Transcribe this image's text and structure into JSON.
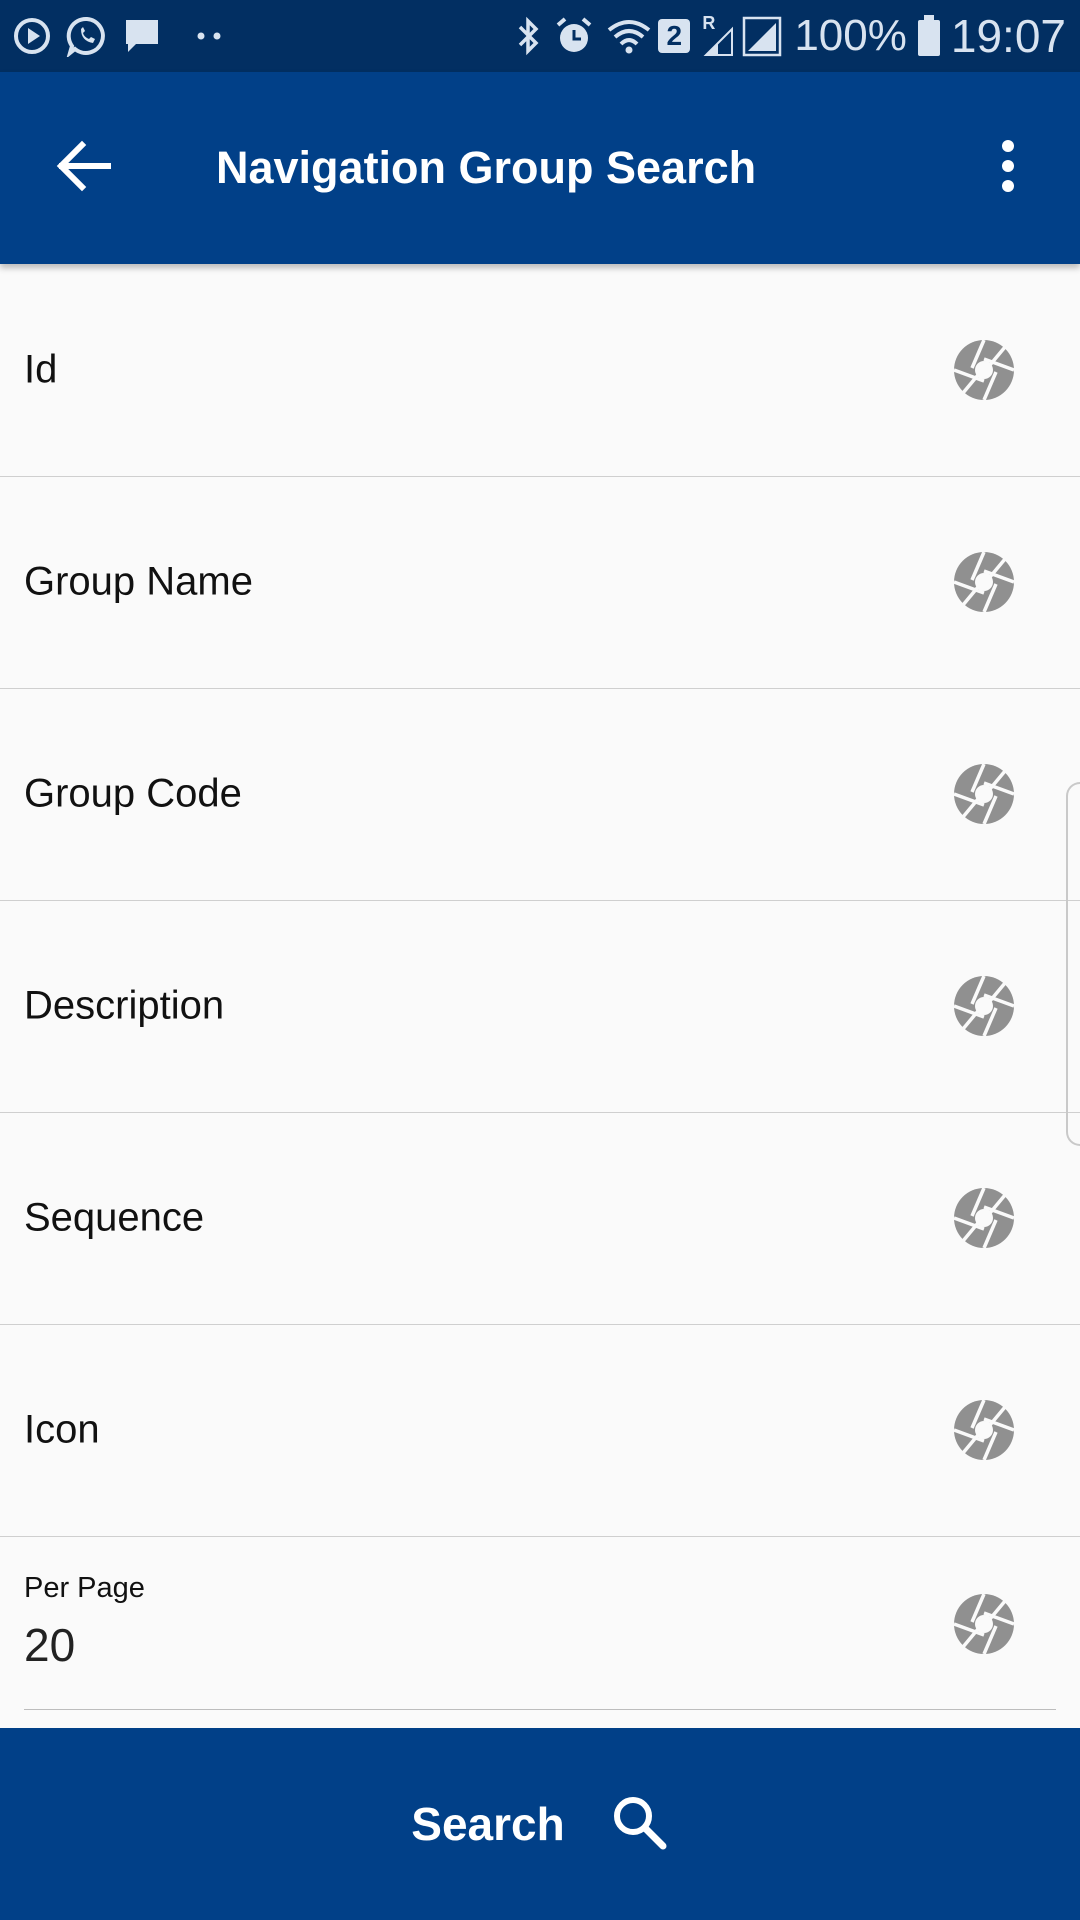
{
  "status_bar": {
    "battery": "100%",
    "time": "19:07",
    "notification_badge": "2",
    "roaming": "R"
  },
  "app_bar": {
    "title": "Navigation Group Search"
  },
  "fields": [
    {
      "label": "Id"
    },
    {
      "label": "Group Name"
    },
    {
      "label": "Group Code"
    },
    {
      "label": "Description"
    },
    {
      "label": "Sequence"
    },
    {
      "label": "Icon"
    }
  ],
  "per_page": {
    "label": "Per Page",
    "value": "20"
  },
  "search_button": {
    "label": "Search"
  },
  "colors": {
    "status_bar": "#022f62",
    "primary": "#014088",
    "icon_gray": "#909090"
  }
}
